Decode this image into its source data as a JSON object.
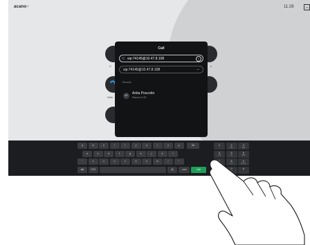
{
  "device": {
    "brand": "acano",
    "brand_chevron": "›",
    "clock": "11:28",
    "topbar_icon": "screen-share-icon"
  },
  "dialog": {
    "title": "Call",
    "input_value": "sip:74145@10.47.8.108",
    "input_icon": "search-icon",
    "clear_icon": "clear-icon",
    "suggestion": "sip:74145@10.47.8.108",
    "suggestion_icon": "arrow-right-icon",
    "recents_header": "Recents",
    "recent_contact": {
      "initials": "AP",
      "name": "Anita Poscotto",
      "detail": "Placed 11:28"
    }
  },
  "keyboard": {
    "row1": [
      "q",
      "w",
      "e",
      "r",
      "t",
      "y",
      "u",
      "i",
      "o",
      "p"
    ],
    "backspace_icon": "backspace-icon",
    "row2": [
      "a",
      "s",
      "d",
      "f",
      "g",
      "h",
      "j",
      "k",
      "l"
    ],
    "row3": [
      "z",
      "x",
      "c",
      "v",
      "b",
      "n",
      "m",
      "/"
    ],
    "shift_left_icon": "shift-icon",
    "shift_right_icon": "shift-icon",
    "emoji_icon": "keyboard-icon",
    "mode_label": "?123",
    "at_label": "@",
    "dotcom_label": ".com",
    "call_label": "Call",
    "numpad": {
      "digits": [
        "1",
        "2",
        "3",
        "4",
        "5",
        "6",
        "7",
        "8",
        "9",
        "*",
        "0",
        "#"
      ],
      "letters": [
        "",
        "ABC",
        "DEF",
        "GHI",
        "JKL",
        "MNO",
        "PQRS",
        "TUV",
        "WXYZ",
        "",
        "+",
        ""
      ]
    }
  },
  "colors": {
    "accent_call": "#1f9e58",
    "screen_bg": "#0f1012",
    "wallpaper": "#d9dbdc"
  }
}
